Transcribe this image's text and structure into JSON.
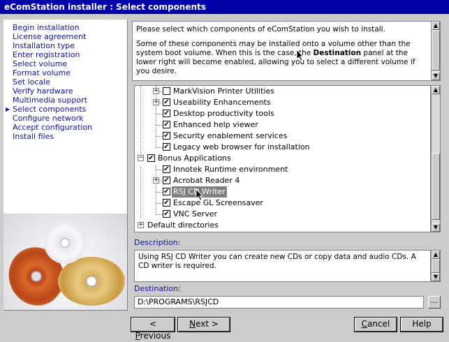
{
  "window": {
    "title": "eComStation installer : Select components"
  },
  "nav": {
    "items": [
      {
        "label": "Begin installation",
        "current": false
      },
      {
        "label": "License agreement",
        "current": false
      },
      {
        "label": "Installation type",
        "current": false
      },
      {
        "label": "Enter registration",
        "current": false
      },
      {
        "label": "Select volume",
        "current": false
      },
      {
        "label": "Format volume",
        "current": false
      },
      {
        "label": "Set locale",
        "current": false
      },
      {
        "label": "Verify hardware",
        "current": false
      },
      {
        "label": "Multimedia support",
        "current": false
      },
      {
        "label": "Select components",
        "current": true
      },
      {
        "label": "Configure network",
        "current": false
      },
      {
        "label": "Accept configuration",
        "current": false
      },
      {
        "label": "Install files",
        "current": false
      }
    ],
    "current_marker": "▶"
  },
  "intro": {
    "line1": "Please select which components of eComStation you wish to install.",
    "line2_before": "Some of these components may be installed onto a volume other than the system boot volume.  When this is the case, the ",
    "line2_bold": "Destination",
    "line2_after": " panel at the lower right will become enabled, allowing you to select a different volume if you desire."
  },
  "tree": {
    "items": [
      {
        "label": "MarkVision Printer Utilities",
        "checked": false,
        "expander": "+",
        "level": 2,
        "selected": false
      },
      {
        "label": "Useability Enhancements",
        "checked": true,
        "expander": "+",
        "level": 2,
        "selected": false
      },
      {
        "label": "Desktop productivity tools",
        "checked": true,
        "expander": "",
        "level": 2,
        "selected": false
      },
      {
        "label": "Enhanced help viewer",
        "checked": true,
        "expander": "",
        "level": 2,
        "selected": false
      },
      {
        "label": "Security enablement services",
        "checked": true,
        "expander": "",
        "level": 2,
        "selected": false
      },
      {
        "label": "Legacy web browser for installation",
        "checked": true,
        "expander": "",
        "level": 2,
        "selected": false
      },
      {
        "label": "Bonus Applications",
        "checked": true,
        "expander": "−",
        "level": 1,
        "selected": false
      },
      {
        "label": "Innotek Runtime environment",
        "checked": true,
        "expander": "",
        "level": 2,
        "selected": false
      },
      {
        "label": "Acrobat Reader 4",
        "checked": true,
        "expander": "+",
        "level": 2,
        "selected": false
      },
      {
        "label": "RSJ CD Writer",
        "checked": true,
        "expander": "",
        "level": 2,
        "selected": true
      },
      {
        "label": "Escape GL Screensaver",
        "checked": true,
        "expander": "",
        "level": 2,
        "selected": false
      },
      {
        "label": "VNC Server",
        "checked": true,
        "expander": "",
        "level": 2,
        "selected": false
      },
      {
        "label": "Default directories",
        "checked": null,
        "expander": "+",
        "level": 0,
        "selected": false
      }
    ],
    "check_glyph": "✔"
  },
  "description": {
    "label": "Description:",
    "text": "Using RSJ CD Writer you can create new CDs or copy data and audio CDs.  A CD writer is required."
  },
  "destination": {
    "label": "Destination:",
    "value": "D:\\PROGRAMS\\RSJCD",
    "browse_label": "..."
  },
  "buttons": {
    "previous_prefix": "< ",
    "previous_u": "P",
    "previous_rest": "revious",
    "next_u": "N",
    "next_rest": "ext >",
    "cancel_u": "C",
    "cancel_rest": "ancel",
    "help": "Help"
  },
  "colors": {
    "titlebar": "#0000a8",
    "nav_text": "#1010a0",
    "window_bg": "#cccccc",
    "selection": "#808080"
  }
}
